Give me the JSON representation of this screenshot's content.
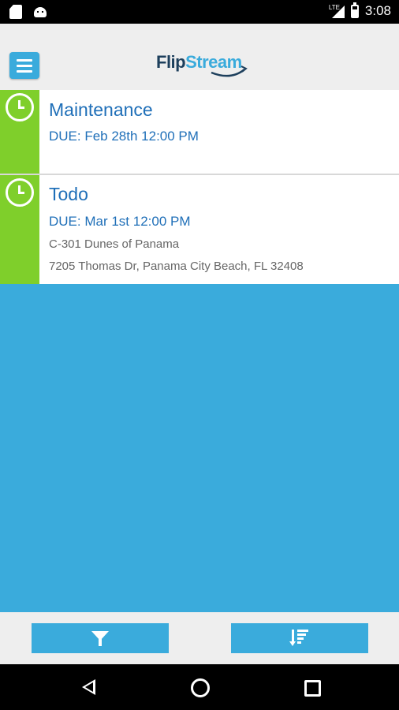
{
  "status_bar": {
    "time": "3:08",
    "network_label": "LTE",
    "icons": [
      "sd-card-icon",
      "android-debug-icon",
      "signal-icon",
      "battery-icon"
    ]
  },
  "header": {
    "logo_part1": "Flip",
    "logo_part2": "Stream",
    "menu_icon": "hamburger-menu-icon"
  },
  "tasks": [
    {
      "title": "Maintenance",
      "due": "DUE: Feb 28th 12:00 PM",
      "address_line1": "",
      "address_line2": ""
    },
    {
      "title": "Todo",
      "due": "DUE: Mar 1st 12:00 PM",
      "address_line1": "C-301 Dunes of Panama",
      "address_line2": "7205 Thomas Dr, Panama City Beach, FL 32408"
    }
  ],
  "bottom_bar": {
    "filter_icon": "filter-icon",
    "sort_icon": "sort-icon"
  },
  "nav_bar": {
    "icons": [
      "back-icon",
      "home-icon",
      "recents-icon"
    ]
  },
  "colors": {
    "accent": "#3aabdc",
    "status_strip": "#7fcf2b",
    "title_text": "#1f6fb8"
  }
}
